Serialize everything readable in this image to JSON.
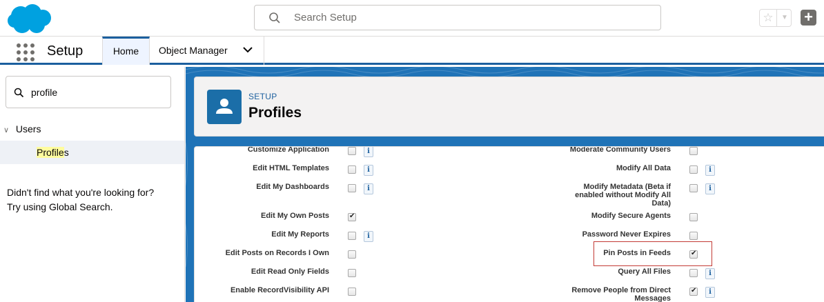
{
  "header": {
    "logo": "salesforce-cloud-logo",
    "search_placeholder": "Search Setup",
    "favorites_icon": "star-icon",
    "add_icon": "plus-icon"
  },
  "nav": {
    "app_name": "Setup",
    "tabs": [
      {
        "label": "Home",
        "active": true
      },
      {
        "label": "Object Manager",
        "active": false
      }
    ]
  },
  "sidebar": {
    "quick_find_value": "profile",
    "tree_parent": "Users",
    "tree_child_prefix": "Profile",
    "tree_child_suffix": "s",
    "not_found_line1": "Didn't find what you're looking for?",
    "not_found_line2": "Try using Global Search."
  },
  "page_header": {
    "eyebrow": "SETUP",
    "title": "Profiles"
  },
  "permissions_left": [
    {
      "label": "Customize Application",
      "checked": false,
      "info": true
    },
    {
      "label": "Edit HTML Templates",
      "checked": false,
      "info": true
    },
    {
      "label": "Edit My Dashboards",
      "checked": false,
      "info": true
    },
    {
      "label": "Edit My Own Posts",
      "checked": true,
      "info": false
    },
    {
      "label": "Edit My Reports",
      "checked": false,
      "info": true
    },
    {
      "label": "Edit Posts on Records I Own",
      "checked": false,
      "info": false
    },
    {
      "label": "Edit Read Only Fields",
      "checked": false,
      "info": false
    },
    {
      "label": "Enable RecordVisibility API",
      "checked": false,
      "info": false
    }
  ],
  "permissions_right": [
    {
      "label": "Moderate Community Users",
      "checked": false,
      "info": false
    },
    {
      "label": "Modify All Data",
      "checked": false,
      "info": true
    },
    {
      "label_lines": [
        "Modify Metadata (Beta if",
        "enabled without Modify All",
        "Data)"
      ],
      "checked": false,
      "info": true
    },
    {
      "label": "Modify Secure Agents",
      "checked": false,
      "info": false
    },
    {
      "label": "Password Never Expires",
      "checked": false,
      "info": false
    },
    {
      "label": "Pin Posts in Feeds",
      "checked": true,
      "info": false,
      "highlighted": true
    },
    {
      "label": "Query All Files",
      "checked": false,
      "info": true
    },
    {
      "label_lines": [
        "Remove People from Direct",
        "Messages"
      ],
      "checked": true,
      "info": true
    }
  ],
  "colors": {
    "brand_blue": "#1b5f9e",
    "highlight_red": "#c23934",
    "search_highlight": "#fffc9e"
  }
}
